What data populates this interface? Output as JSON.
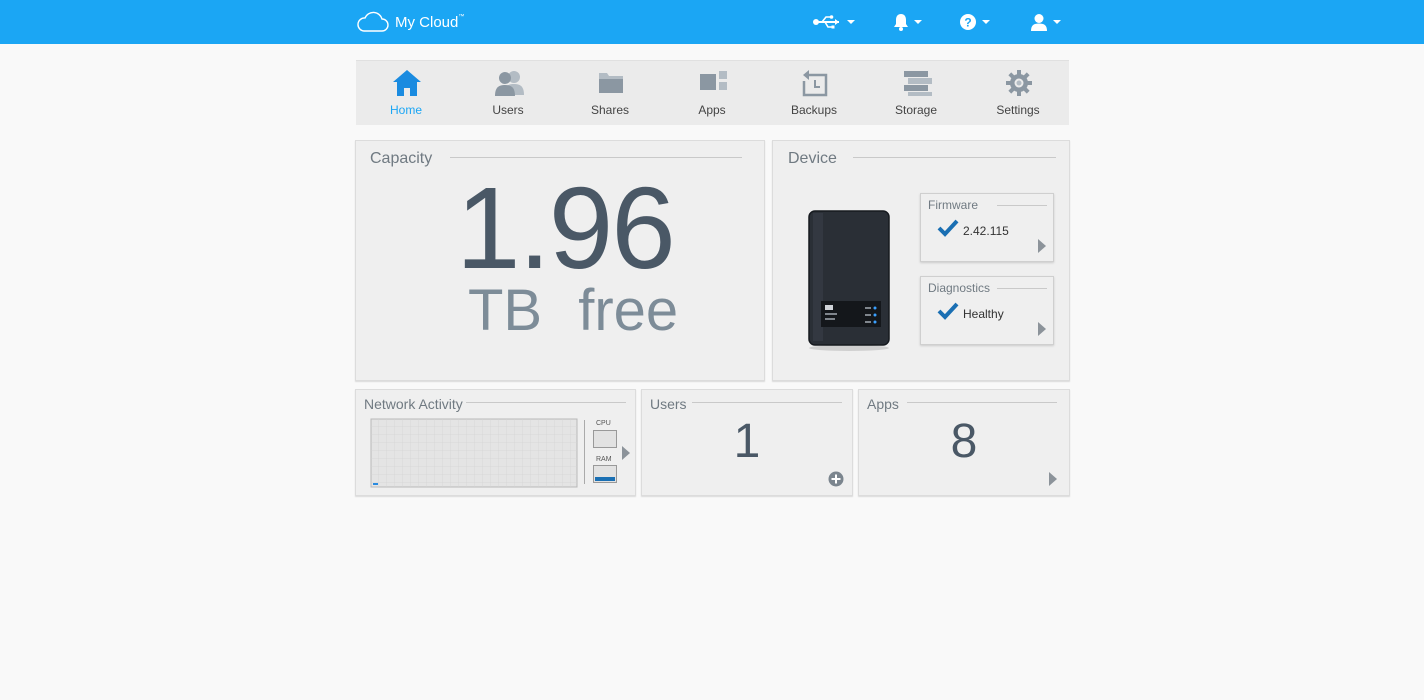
{
  "header": {
    "brand": "My Cloud",
    "trademark": "™",
    "icons": [
      "cloud-icon",
      "usb-icon",
      "bell-icon",
      "help-icon",
      "user-icon"
    ],
    "bg_color": "#1ba6f4"
  },
  "nav": {
    "items": [
      {
        "label": "Home",
        "icon": "home-icon",
        "active": true
      },
      {
        "label": "Users",
        "icon": "users-icon"
      },
      {
        "label": "Shares",
        "icon": "folder-icon"
      },
      {
        "label": "Apps",
        "icon": "apps-icon"
      },
      {
        "label": "Backups",
        "icon": "backup-icon"
      },
      {
        "label": "Storage",
        "icon": "storage-icon"
      },
      {
        "label": "Settings",
        "icon": "gear-icon"
      }
    ],
    "active_color": "#1ba6f4"
  },
  "capacity": {
    "title": "Capacity",
    "value": "1.96",
    "unit": "TB free"
  },
  "device": {
    "title": "Device",
    "firmware": {
      "title": "Firmware",
      "value": "2.42.115"
    },
    "diagnostics": {
      "title": "Diagnostics",
      "value": "Healthy"
    }
  },
  "network": {
    "title": "Network Activity",
    "cpu_label": "CPU",
    "ram_label": "RAM"
  },
  "users": {
    "title": "Users",
    "count": "1"
  },
  "apps": {
    "title": "Apps",
    "count": "8"
  }
}
